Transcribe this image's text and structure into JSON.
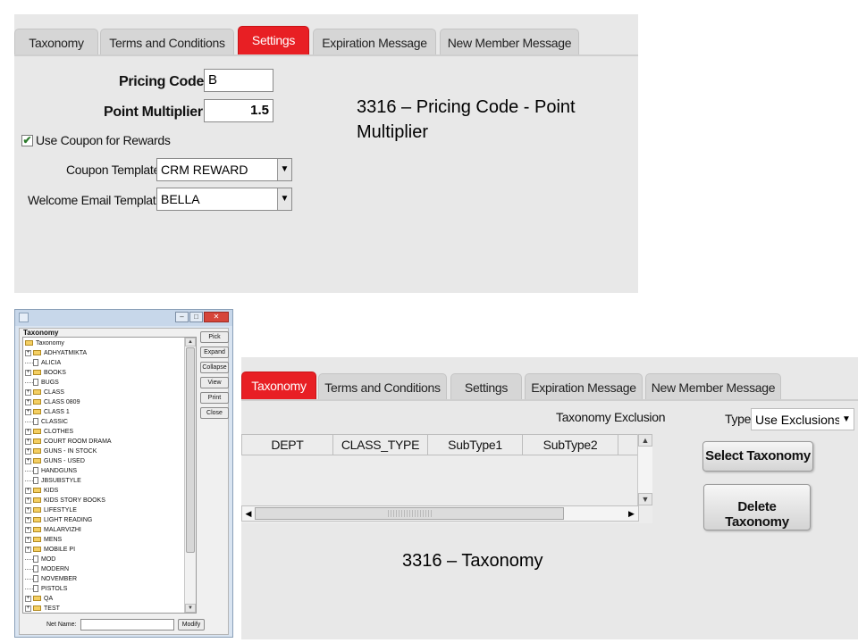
{
  "top_panel": {
    "tabs": [
      {
        "label": "Taxonomy",
        "active": false
      },
      {
        "label": "Terms and Conditions",
        "active": false
      },
      {
        "label": "Settings",
        "active": true
      },
      {
        "label": "Expiration Message",
        "active": false
      },
      {
        "label": "New Member Message",
        "active": false
      }
    ],
    "pricing_code": {
      "label": "Pricing Code",
      "value": "B"
    },
    "point_multiplier": {
      "label": "Point Multiplier",
      "value": "1.5"
    },
    "use_coupon": {
      "label": "Use Coupon for Rewards",
      "checked": true
    },
    "coupon_template": {
      "label": "Coupon Template",
      "value": "CRM REWARD"
    },
    "welcome_email_template": {
      "label": "Welcome Email Template",
      "value": "BELLA"
    },
    "caption": "3316 – Pricing Code - Point Multiplier"
  },
  "tree_window": {
    "group_title": "Taxonomy",
    "root": "Taxonomy",
    "items": [
      {
        "label": "ADHYATMIKTA",
        "type": "folder"
      },
      {
        "label": "ALICIA",
        "type": "doc"
      },
      {
        "label": "BOOKS",
        "type": "folder"
      },
      {
        "label": "BUGS",
        "type": "doc"
      },
      {
        "label": "CLASS",
        "type": "folder"
      },
      {
        "label": "CLASS 0809",
        "type": "folder"
      },
      {
        "label": "CLASS 1",
        "type": "folder"
      },
      {
        "label": "CLASSIC",
        "type": "doc"
      },
      {
        "label": "CLOTHES",
        "type": "folder"
      },
      {
        "label": "COURT ROOM DRAMA",
        "type": "folder"
      },
      {
        "label": "GUNS - IN STOCK",
        "type": "folder"
      },
      {
        "label": "GUNS - USED",
        "type": "folder"
      },
      {
        "label": "HANDGUNS",
        "type": "doc"
      },
      {
        "label": "JBSUBSTYLE",
        "type": "doc"
      },
      {
        "label": "KIDS",
        "type": "folder"
      },
      {
        "label": "KIDS STORY BOOKS",
        "type": "folder"
      },
      {
        "label": "LIFESTYLE",
        "type": "folder"
      },
      {
        "label": "LIGHT READING",
        "type": "folder"
      },
      {
        "label": "MALARVIZHI",
        "type": "folder"
      },
      {
        "label": "MENS",
        "type": "folder"
      },
      {
        "label": "MOBILE PI",
        "type": "folder"
      },
      {
        "label": "MOD",
        "type": "doc"
      },
      {
        "label": "MODERN",
        "type": "doc"
      },
      {
        "label": "NOVEMBER",
        "type": "doc"
      },
      {
        "label": "PISTOLS",
        "type": "doc"
      },
      {
        "label": "QA",
        "type": "folder"
      },
      {
        "label": "TEST",
        "type": "folder"
      }
    ],
    "buttons": [
      "Pick",
      "Expand",
      "Collapse",
      "View",
      "Print",
      "Close"
    ],
    "net_name_label": "Net Name:",
    "net_name_value": "",
    "modify_label": "Modify",
    "window_controls": {
      "minimize": "–",
      "maximize": "□",
      "close": "✕"
    }
  },
  "bottom_panel": {
    "tabs": [
      {
        "label": "Taxonomy",
        "active": true
      },
      {
        "label": "Terms and Conditions",
        "active": false
      },
      {
        "label": "Settings",
        "active": false
      },
      {
        "label": "Expiration Message",
        "active": false
      },
      {
        "label": "New Member Message",
        "active": false
      }
    ],
    "exclusion_label": "Taxonomy Exclusion",
    "type_label": "Type",
    "type_value": "Use Exclusions",
    "columns": [
      "DEPT",
      "CLASS_TYPE",
      "SubType1",
      "SubType2"
    ],
    "select_button": "Select Taxonomy",
    "delete_button": "Delete Taxonomy",
    "caption": "3316 – Taxonomy"
  },
  "colors": {
    "accent_tab": "#e81f24",
    "panel_bg": "#e8e8e8"
  }
}
